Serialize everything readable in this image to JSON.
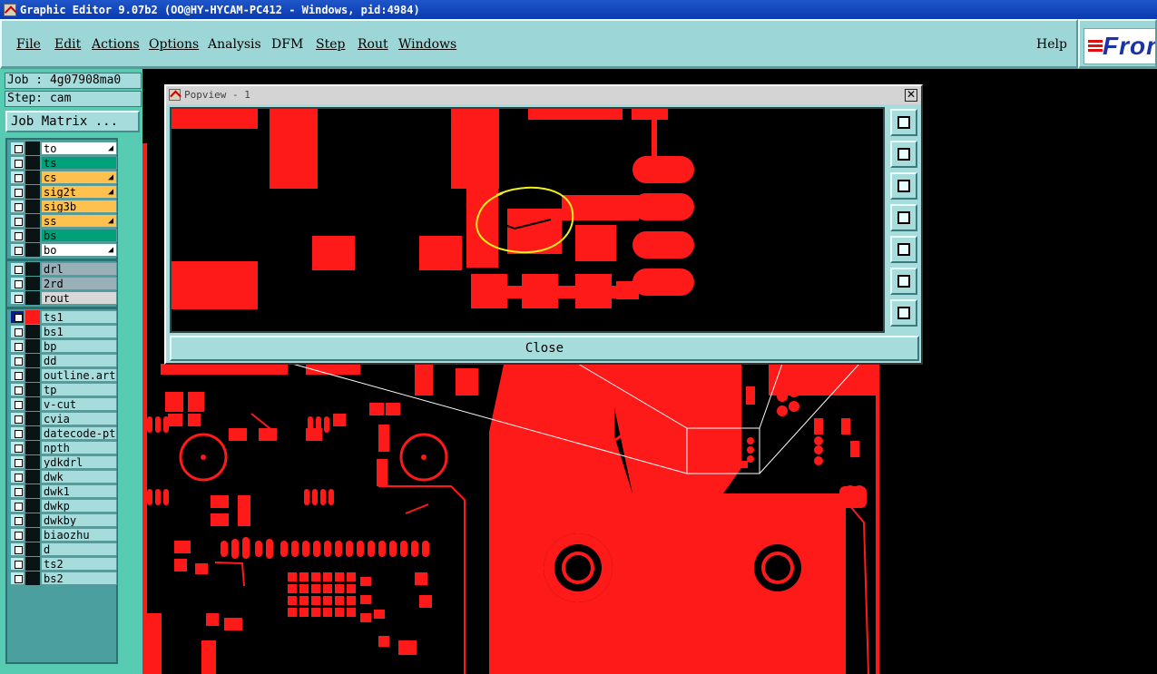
{
  "window": {
    "title": "Graphic Editor 9.07b2 (OO@HY-HYCAM-PC412 - Windows, pid:4984)"
  },
  "menu": {
    "file": "File",
    "edit": "Edit",
    "actions": "Actions",
    "options": "Options",
    "analysis": "Analysis",
    "dfm": "DFM",
    "step": "Step",
    "rout": "Rout",
    "windows": "Windows",
    "help": "Help"
  },
  "logo": {
    "text": "Fron"
  },
  "job": {
    "label": "Job : 4g07908ma0",
    "step": "Step: cam",
    "matrix_button": "Job Matrix ..."
  },
  "layers": {
    "signal": [
      {
        "name": "to",
        "color": "#ffffff",
        "arrow": true
      },
      {
        "name": "ts",
        "color": "#00a07a",
        "arrow": false
      },
      {
        "name": "cs",
        "color": "#ffc14d",
        "arrow": true
      },
      {
        "name": "sig2t",
        "color": "#ffc14d",
        "arrow": true
      },
      {
        "name": "sig3b",
        "color": "#ffc14d",
        "arrow": false
      },
      {
        "name": "ss",
        "color": "#ffc14d",
        "arrow": true
      },
      {
        "name": "bs",
        "color": "#00a07a",
        "arrow": false
      },
      {
        "name": "bo",
        "color": "#ffffff",
        "arrow": true
      }
    ],
    "drill": [
      {
        "name": "drl",
        "color": "#9ab0b8"
      },
      {
        "name": "2rd",
        "color": "#9ab0b8"
      },
      {
        "name": "rout",
        "color": "#d8d8d8"
      }
    ],
    "misc": [
      {
        "name": "ts1"
      },
      {
        "name": "bs1"
      },
      {
        "name": "bp"
      },
      {
        "name": "dd"
      },
      {
        "name": "outline.art"
      },
      {
        "name": "tp"
      },
      {
        "name": "v-cut"
      },
      {
        "name": "cvia"
      },
      {
        "name": "datecode-pte"
      },
      {
        "name": "npth"
      },
      {
        "name": "ydkdrl"
      },
      {
        "name": "dwk"
      },
      {
        "name": "dwk1"
      },
      {
        "name": "dwkp"
      },
      {
        "name": "dwkby"
      },
      {
        "name": "biaozhu"
      },
      {
        "name": "d"
      },
      {
        "name": "ts2"
      },
      {
        "name": "bs2"
      }
    ]
  },
  "popview": {
    "title": "Popview - 1",
    "close_label": "Close",
    "close_x": "✕"
  },
  "colors": {
    "pcb": "#ff0000",
    "annotation": "#f3f01a",
    "menu_bg": "#9dd6d6",
    "panel_bg": "#58ccb3"
  }
}
